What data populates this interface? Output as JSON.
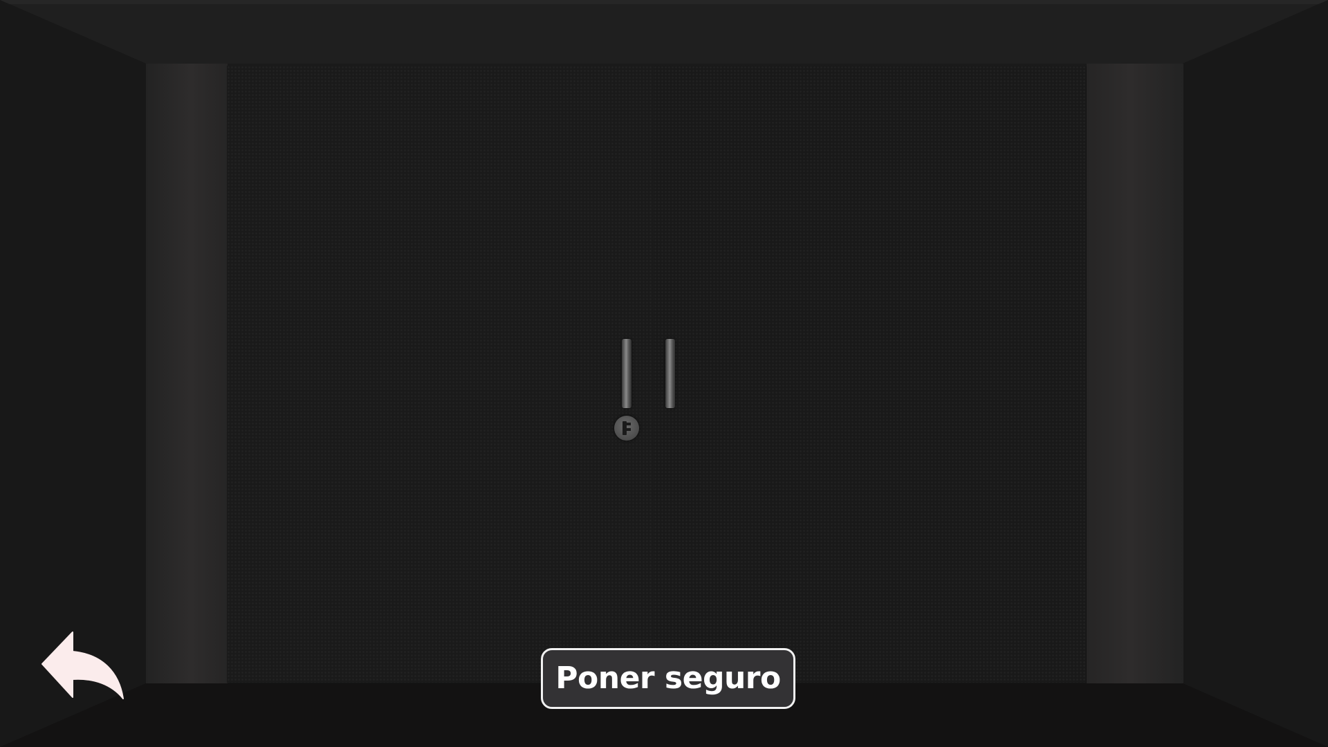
{
  "scene": {
    "name": "locked-door-room",
    "background_color": "#151515",
    "frame_color": "#1c1c1c",
    "floor_color": "#131212"
  },
  "controls": {
    "lock_button_label": "Poner seguro",
    "back_icon": "back-arrow-icon",
    "back_icon_color": "#fbecec"
  },
  "door": {
    "handles": 2,
    "lock_knob_icon": "lock-knob-icon"
  }
}
